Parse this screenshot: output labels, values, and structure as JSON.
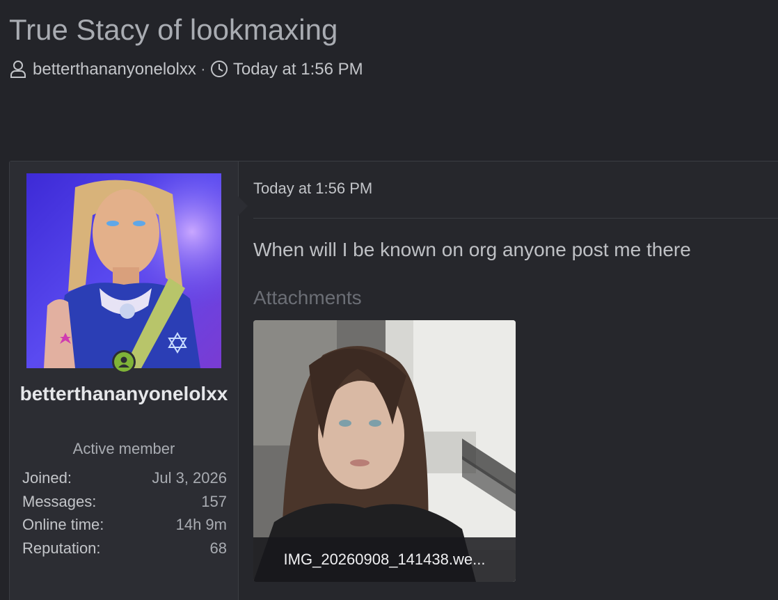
{
  "thread": {
    "title": "True Stacy of lookmaxing",
    "author": "betterthananyonelolxx",
    "separator": "·",
    "date": "Today at 1:56 PM"
  },
  "user": {
    "name": "betterthananyonelolxx",
    "title": "Active member",
    "status": "online",
    "stats": [
      {
        "label": "Joined:",
        "value": "Jul 3, 2026"
      },
      {
        "label": "Messages:",
        "value": "157"
      },
      {
        "label": "Online time:",
        "value": "14h 9m"
      },
      {
        "label": "Reputation:",
        "value": "68"
      }
    ]
  },
  "post": {
    "date": "Today at 1:56 PM",
    "body": "When will I be known on org anyone post me there",
    "attachments_heading": "Attachments",
    "attachment": {
      "filename": "IMG_20260908_141438.we..."
    }
  },
  "colors": {
    "background": "#232429",
    "panel": "#2c2d33",
    "border": "#3b3d43",
    "online": "#7fb338"
  }
}
